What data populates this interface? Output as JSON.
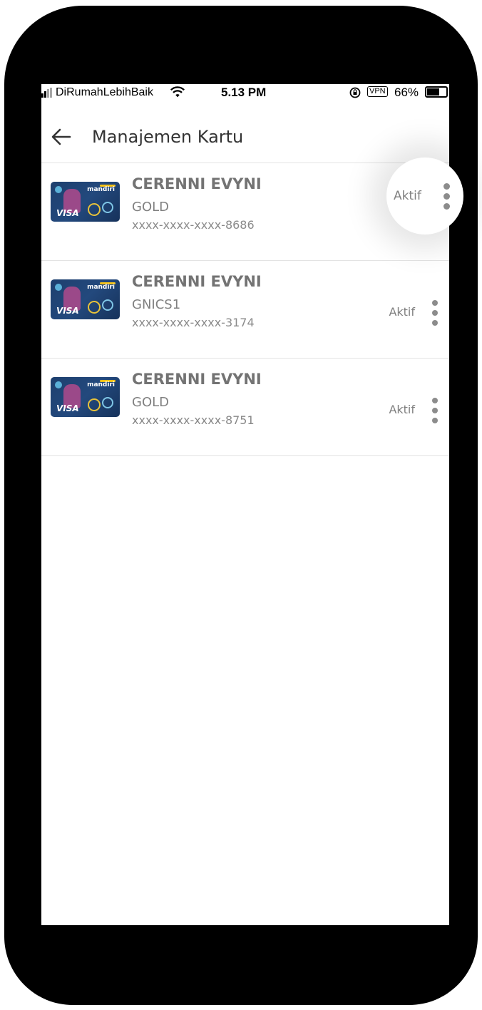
{
  "status_bar": {
    "carrier": "DiRumahLebihBaik",
    "time": "5.13 PM",
    "vpn": "VPN",
    "battery": "66%",
    "battery_level": 0.66
  },
  "header": {
    "title": "Manajemen Kartu"
  },
  "cards": [
    {
      "name": "CERENNI EVYNI",
      "type": "GOLD",
      "number": "xxxx-xxxx-xxxx-8686",
      "status": "Aktif",
      "bank": "mandiri",
      "network": "VISA"
    },
    {
      "name": "CERENNI EVYNI",
      "type": "GNICS1",
      "number": "xxxx-xxxx-xxxx-3174",
      "status": "Aktif",
      "bank": "mandiri",
      "network": "VISA"
    },
    {
      "name": "CERENNI EVYNI",
      "type": "GOLD",
      "number": "xxxx-xxxx-xxxx-8751",
      "status": "Aktif",
      "bank": "mandiri",
      "network": "VISA"
    }
  ],
  "colors": {
    "text_primary": "#737373",
    "text_secondary": "#808080",
    "divider": "#e3e3e3",
    "card_bg": "#1d3f6e"
  }
}
